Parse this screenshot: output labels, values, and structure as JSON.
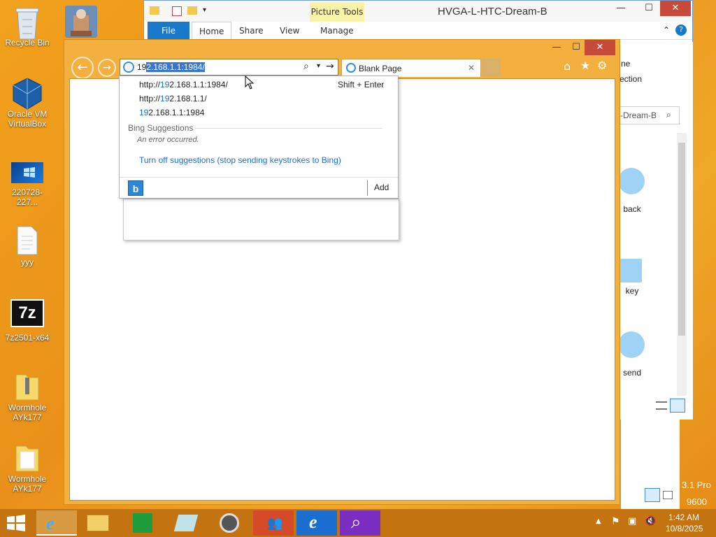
{
  "desktop": {
    "icons": [
      {
        "label": "Recycle Bin"
      },
      {
        "label": "Oracle VM VirtualBox"
      },
      {
        "label": "220728-227..."
      },
      {
        "label": "yyy"
      },
      {
        "label": "7z2501-x64"
      },
      {
        "label": "Wormhole AYk177"
      },
      {
        "label": "Wormhole AYk177"
      }
    ],
    "sevenzip_glyph": "7z"
  },
  "explorer": {
    "title": "HVGA-L-HTC-Dream-B",
    "picture_tools": "Picture Tools",
    "tabs": [
      "File",
      "Home",
      "Share",
      "View",
      "Manage"
    ],
    "side_snippets": [
      "ne",
      "ection"
    ],
    "search_fragment": "-Dream-B",
    "items": [
      {
        "label": "back"
      },
      {
        "label": "key"
      },
      {
        "label": "send"
      }
    ],
    "watermark": [
      "3.1 Pro",
      "9600"
    ]
  },
  "ie": {
    "address_typed": "19",
    "address_autocomplete": "2.168.1.1:1984/",
    "tab_title": "Blank Page",
    "dropdown": {
      "suggestions": [
        {
          "prefix": "http://",
          "hl": "19",
          "rest": "2.168.1.1:1984/"
        },
        {
          "prefix": "http://",
          "hl": "19",
          "rest": "2.168.1.1/"
        },
        {
          "prefix": "",
          "hl": "19",
          "rest": "2.168.1.1:1984"
        }
      ],
      "shortcut_hint": "Shift + Enter",
      "bing_header": "Bing Suggestions",
      "error_text": "An error occurred.",
      "turn_off": "Turn off suggestions (stop sending keystrokes to Bing)",
      "add_label": "Add",
      "bing_glyph": "b"
    }
  },
  "taskbar": {
    "time": "1:42 AM",
    "date": "10/8/2025"
  },
  "colors": {
    "desktop": "#ee9a1c",
    "ie_frame": "#f3b03e",
    "taskbar": "#c37410",
    "link": "#1a6dd8",
    "selection": "#3a76d0"
  }
}
